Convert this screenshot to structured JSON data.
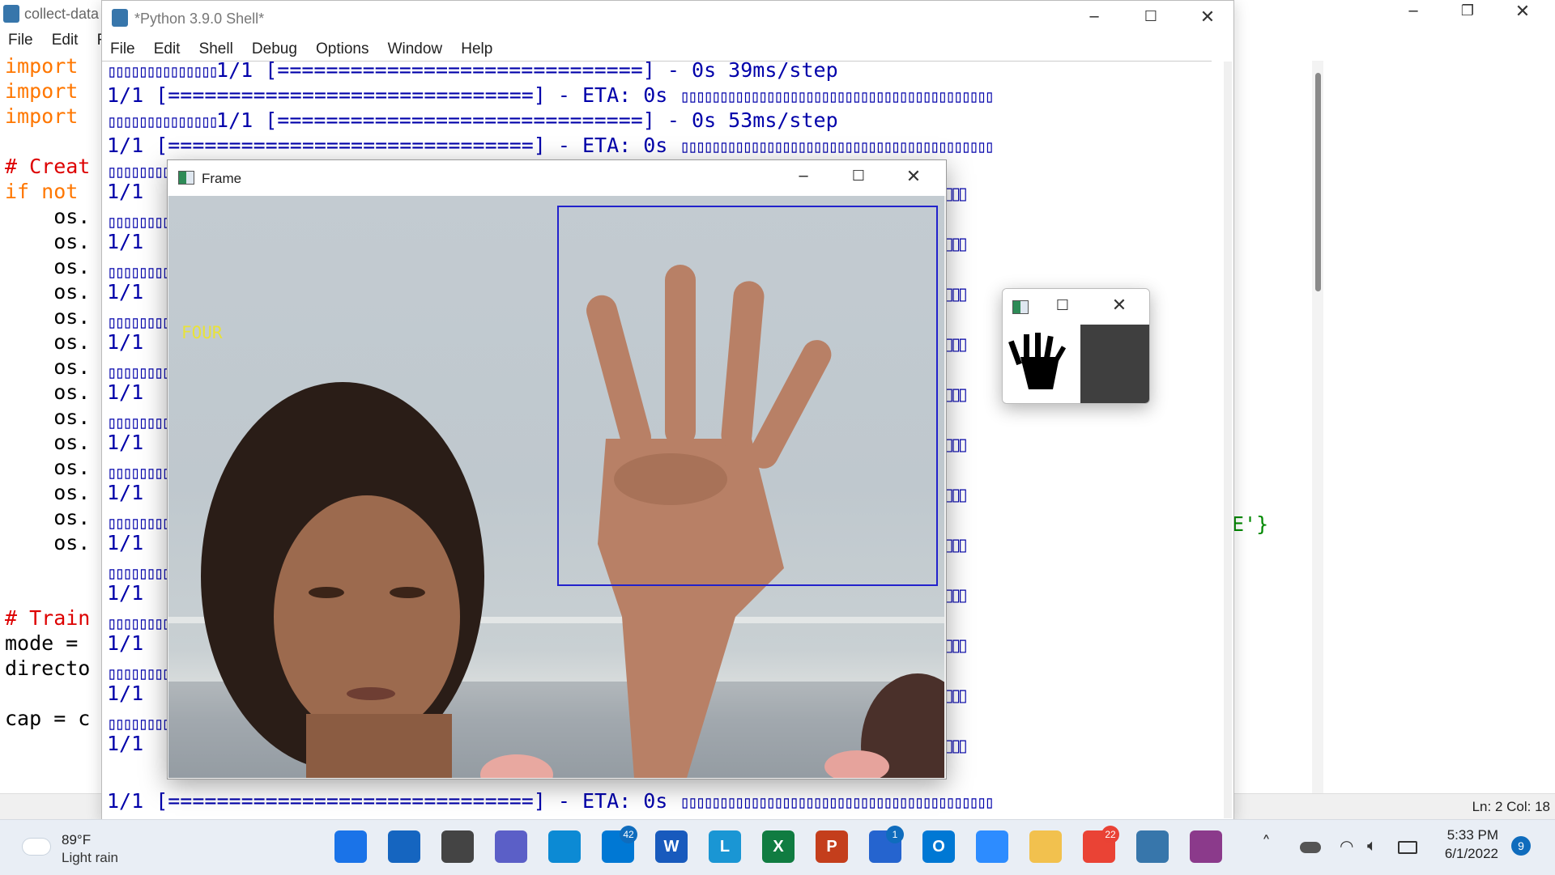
{
  "editor": {
    "title": "collect-data",
    "menu": [
      "File",
      "Edit",
      "Fo"
    ],
    "code_lines": [
      {
        "text": "import",
        "kind": "kw"
      },
      {
        "text": "import",
        "kind": "kw"
      },
      {
        "text": "import",
        "kind": "kw"
      },
      {
        "text": "",
        "kind": "nm"
      },
      {
        "text": "# Creat",
        "kind": "cm"
      },
      {
        "text": "if not",
        "kind": "kw"
      },
      {
        "text": "    os.",
        "kind": "nm"
      },
      {
        "text": "    os.",
        "kind": "nm"
      },
      {
        "text": "    os.",
        "kind": "nm"
      },
      {
        "text": "    os.",
        "kind": "nm"
      },
      {
        "text": "    os.",
        "kind": "nm"
      },
      {
        "text": "    os.",
        "kind": "nm"
      },
      {
        "text": "    os.",
        "kind": "nm"
      },
      {
        "text": "    os.",
        "kind": "nm"
      },
      {
        "text": "    os.",
        "kind": "nm"
      },
      {
        "text": "    os.",
        "kind": "nm"
      },
      {
        "text": "    os.",
        "kind": "nm"
      },
      {
        "text": "    os.",
        "kind": "nm"
      },
      {
        "text": "    os.",
        "kind": "nm"
      },
      {
        "text": "    os.",
        "kind": "nm"
      },
      {
        "text": "",
        "kind": "nm"
      },
      {
        "text": "",
        "kind": "nm"
      },
      {
        "text": "# Train",
        "kind": "cm"
      },
      {
        "text": "mode =",
        "kind": "nm"
      },
      {
        "text": "directo",
        "kind": "nm"
      },
      {
        "text": "",
        "kind": "nm"
      },
      {
        "text": "cap = c",
        "kind": "nm"
      }
    ],
    "right_fragment": "E'}",
    "status": "Ln: 2  Col: 18"
  },
  "shell": {
    "title": "*Python 3.9.0 Shell*",
    "menu": [
      "File",
      "Edit",
      "Shell",
      "Debug",
      "Options",
      "Window",
      "Help"
    ],
    "lines": [
      {
        "prefix": "▯▯▯▯▯▯▯▯▯▯▯▯▯▯",
        "text": "1/1 [==============================] - 0s 39ms/step",
        "suffix": ""
      },
      {
        "prefix": "",
        "text": "1/1 [==============================] - ETA: 0s ",
        "suffix": "▯▯▯▯▯▯▯▯▯▯▯▯▯▯▯▯▯▯▯▯▯▯▯▯▯▯▯▯▯▯▯▯▯▯▯▯▯▯▯▯"
      },
      {
        "prefix": "▯▯▯▯▯▯▯▯▯▯▯▯▯▯",
        "text": "1/1 [==============================] - 0s 53ms/step",
        "suffix": ""
      },
      {
        "prefix": "",
        "text": "1/1 [==============================] - ETA: 0s ",
        "suffix": "▯▯▯▯▯▯▯▯▯▯▯▯▯▯▯▯▯▯▯▯▯▯▯▯▯▯▯▯▯▯▯▯▯▯▯▯▯▯▯▯"
      }
    ],
    "repeat_line": "1/1",
    "last_line": "1/1 [==============================] - ETA: 0s "
  },
  "frame": {
    "title": "Frame",
    "label": "FOUR",
    "label_color": "#e8e23a",
    "roi_color": "#2222cc"
  },
  "mask_window": {
    "title": ""
  },
  "taskbar": {
    "weather_temp": "89°F",
    "weather_desc": "Light rain",
    "time": "5:33 PM",
    "date": "6/1/2022",
    "notification_count": "9",
    "mail_badge": "42",
    "todo_badge": "1",
    "chrome_badge": "22",
    "apps": [
      {
        "name": "start",
        "label": "",
        "color": "#1a73e8"
      },
      {
        "name": "search",
        "label": "",
        "color": "#1565c0"
      },
      {
        "name": "task-view",
        "label": "",
        "color": "#444444"
      },
      {
        "name": "teams-chat",
        "label": "",
        "color": "#5b5fc7"
      },
      {
        "name": "edge",
        "label": "",
        "color": "#0c8ad4"
      },
      {
        "name": "mail",
        "label": "",
        "color": "#0078d4"
      },
      {
        "name": "word",
        "label": "W",
        "color": "#185abd"
      },
      {
        "name": "l-app",
        "label": "L",
        "color": "#1a96d4"
      },
      {
        "name": "excel",
        "label": "X",
        "color": "#107c41"
      },
      {
        "name": "powerpoint",
        "label": "P",
        "color": "#c43e1c"
      },
      {
        "name": "todo",
        "label": "",
        "color": "#2564cf"
      },
      {
        "name": "outlook",
        "label": "O",
        "color": "#0078d4"
      },
      {
        "name": "zoom",
        "label": "",
        "color": "#2d8cff"
      },
      {
        "name": "file-explorer",
        "label": "",
        "color": "#f2c14e"
      },
      {
        "name": "chrome",
        "label": "",
        "color": "#ea4335"
      },
      {
        "name": "python-idle",
        "label": "",
        "color": "#3776ab"
      },
      {
        "name": "winrar",
        "label": "",
        "color": "#8b3a8b"
      }
    ]
  }
}
